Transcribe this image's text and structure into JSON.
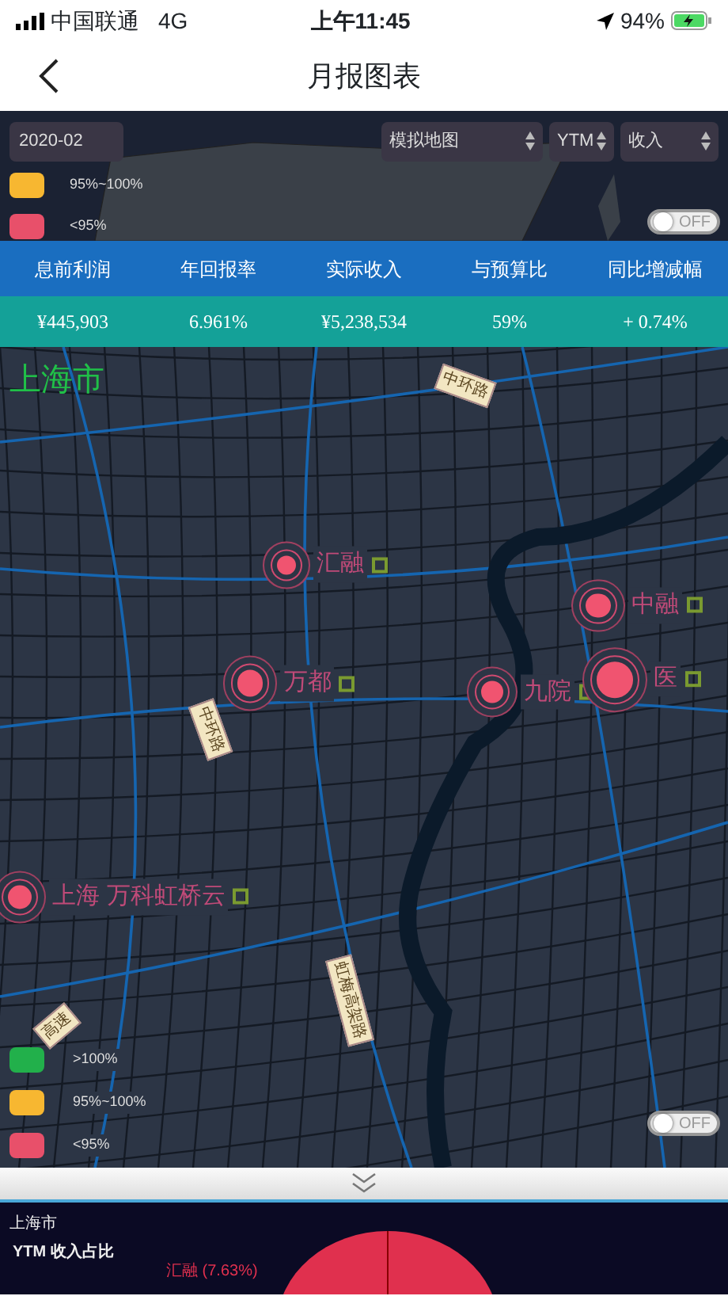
{
  "status_bar": {
    "carrier": "中国联通",
    "network": "4G",
    "time": "上午11:45",
    "battery": "94%"
  },
  "nav": {
    "title": "月报图表"
  },
  "filters": {
    "date": "2020-02",
    "selects": [
      {
        "value": "模拟地图"
      },
      {
        "value": "YTM"
      },
      {
        "value": "收入"
      }
    ]
  },
  "top_legend": [
    {
      "label": "95%~100%",
      "color": "#f7b731"
    },
    {
      "label": "<95%",
      "color": "#e8506a"
    }
  ],
  "top_toggle": {
    "label": "OFF",
    "on": false
  },
  "summary": {
    "columns": [
      "息前利润",
      "年回报率",
      "实际收入",
      "与预算比",
      "同比增减幅"
    ],
    "values": [
      "¥445,903",
      "6.961%",
      "¥5,238,534",
      "59%",
      "+ 0.74%"
    ]
  },
  "map": {
    "region": "上海市",
    "roads": [
      {
        "label": "中环路"
      },
      {
        "label": "中环路"
      },
      {
        "label": "虹梅高架路"
      },
      {
        "label": "高速"
      }
    ],
    "sites": [
      {
        "label": "汇融"
      },
      {
        "label": "中融"
      },
      {
        "label": "万都"
      },
      {
        "label": "九院"
      },
      {
        "label": "医"
      },
      {
        "label": "上海 万科虹桥云"
      }
    ],
    "legend": [
      {
        "label": ">100%",
        "color": "#22b04b"
      },
      {
        "label": "95%~100%",
        "color": "#f7b731"
      },
      {
        "label": "<95%",
        "color": "#e8506a"
      }
    ],
    "toggle": {
      "label": "OFF",
      "on": false
    }
  },
  "bottom": {
    "region": "上海市",
    "title": "YTM 收入占比",
    "pie_label": "汇融 (7.63%)"
  }
}
